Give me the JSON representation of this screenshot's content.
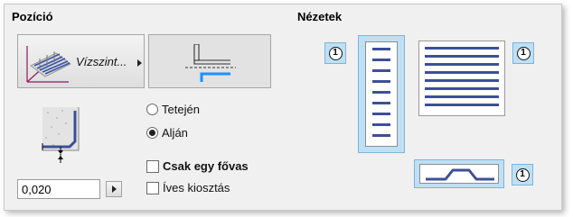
{
  "position_section": {
    "title": "Pozíció",
    "placement_button_label": "Vízszint...",
    "radio_top_label": "Tetején",
    "radio_bottom_label": "Alján",
    "selected_radio": "bottom",
    "offset_value": "0,020",
    "checkbox_single_bar_label": "Csak egy fővas",
    "checkbox_single_bar_checked": false,
    "checkbox_curved_label": "Íves kiosztás",
    "checkbox_curved_checked": false
  },
  "views_section": {
    "title": "Nézetek",
    "badge_top_left": "1",
    "badge_top_right": "1",
    "badge_bottom": "1",
    "vertical_view_bar_count": 9,
    "horizontal_view_bar_count": 9
  },
  "colors": {
    "accent_blue": "#1e90ff",
    "view_highlight": "#bfe0f4",
    "bar_blue": "#3c4f9a"
  }
}
